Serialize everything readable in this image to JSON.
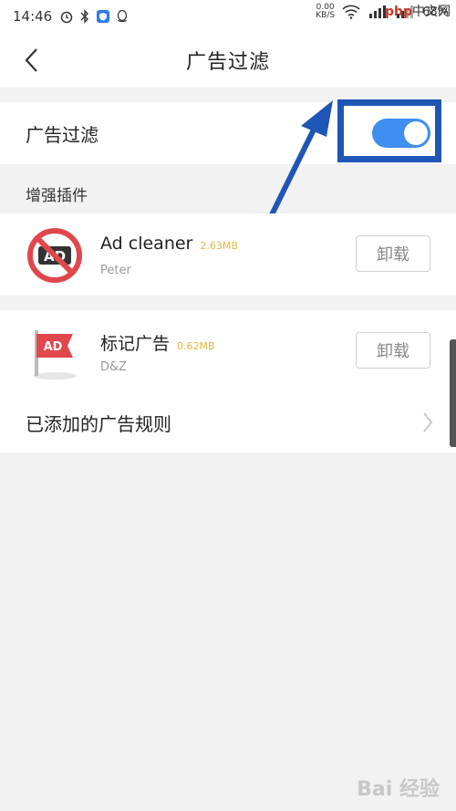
{
  "status_bar": {
    "time": "14:46",
    "net_speed_value": "0.00",
    "net_speed_unit": "KB/S",
    "battery": "68%"
  },
  "watermark_top": {
    "brand": "php",
    "suffix": "中文网"
  },
  "nav": {
    "title": "广告过滤"
  },
  "ad_filter": {
    "label": "广告过滤",
    "enabled": true
  },
  "section": {
    "label": "增强插件"
  },
  "plugins": [
    {
      "name": "Ad cleaner",
      "size": "2.63MB",
      "author": "Peter",
      "action": "卸载"
    },
    {
      "name": "标记广告",
      "size": "0.62MB",
      "author": "D&Z",
      "action": "卸载"
    }
  ],
  "rules": {
    "label": "已添加的广告规则"
  },
  "watermark_bottom": "Bai 经验",
  "colors": {
    "accent": "#3f8ef0",
    "highlight": "#1f56b6",
    "size_text": "#e0b840"
  }
}
